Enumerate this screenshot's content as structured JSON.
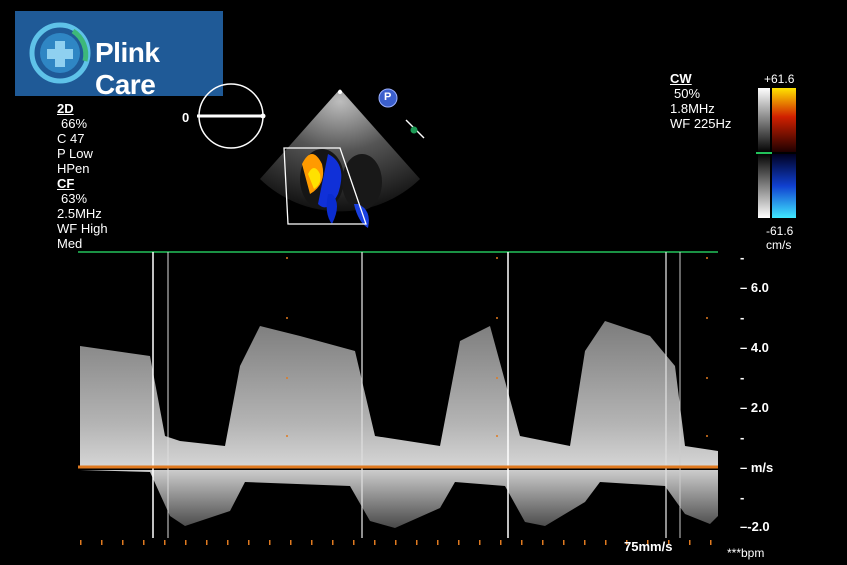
{
  "logo": {
    "text": "Plink Care",
    "brand_color": "#1f5a97",
    "icon": "medical-cross-icon"
  },
  "settings_2d": {
    "header": "2D",
    "lines": [
      "66%",
      "C 47",
      "P Low",
      "HPen"
    ]
  },
  "settings_cf": {
    "header": "CF",
    "lines": [
      "63%",
      "2.5MHz",
      "WF High",
      "Med"
    ]
  },
  "settings_cw": {
    "header": "CW",
    "lines": [
      "50%",
      "1.8MHz",
      "WF 225Hz"
    ]
  },
  "color_scale": {
    "top": "+61.6",
    "bottom": "-61.6",
    "unit": "cm/s"
  },
  "angle_dial": {
    "value": "0"
  },
  "probe_marker": {
    "text": "P"
  },
  "velocity_scale": {
    "labels": [
      "6.0",
      "4.0",
      "2.0",
      "m/s",
      "-2.0"
    ]
  },
  "sweep_speed": "75mm/s",
  "heart_rate": "***bpm",
  "colors": {
    "baseline": "#e07a20",
    "ecg_line": "#22c25a",
    "accent": "#ffffff"
  }
}
